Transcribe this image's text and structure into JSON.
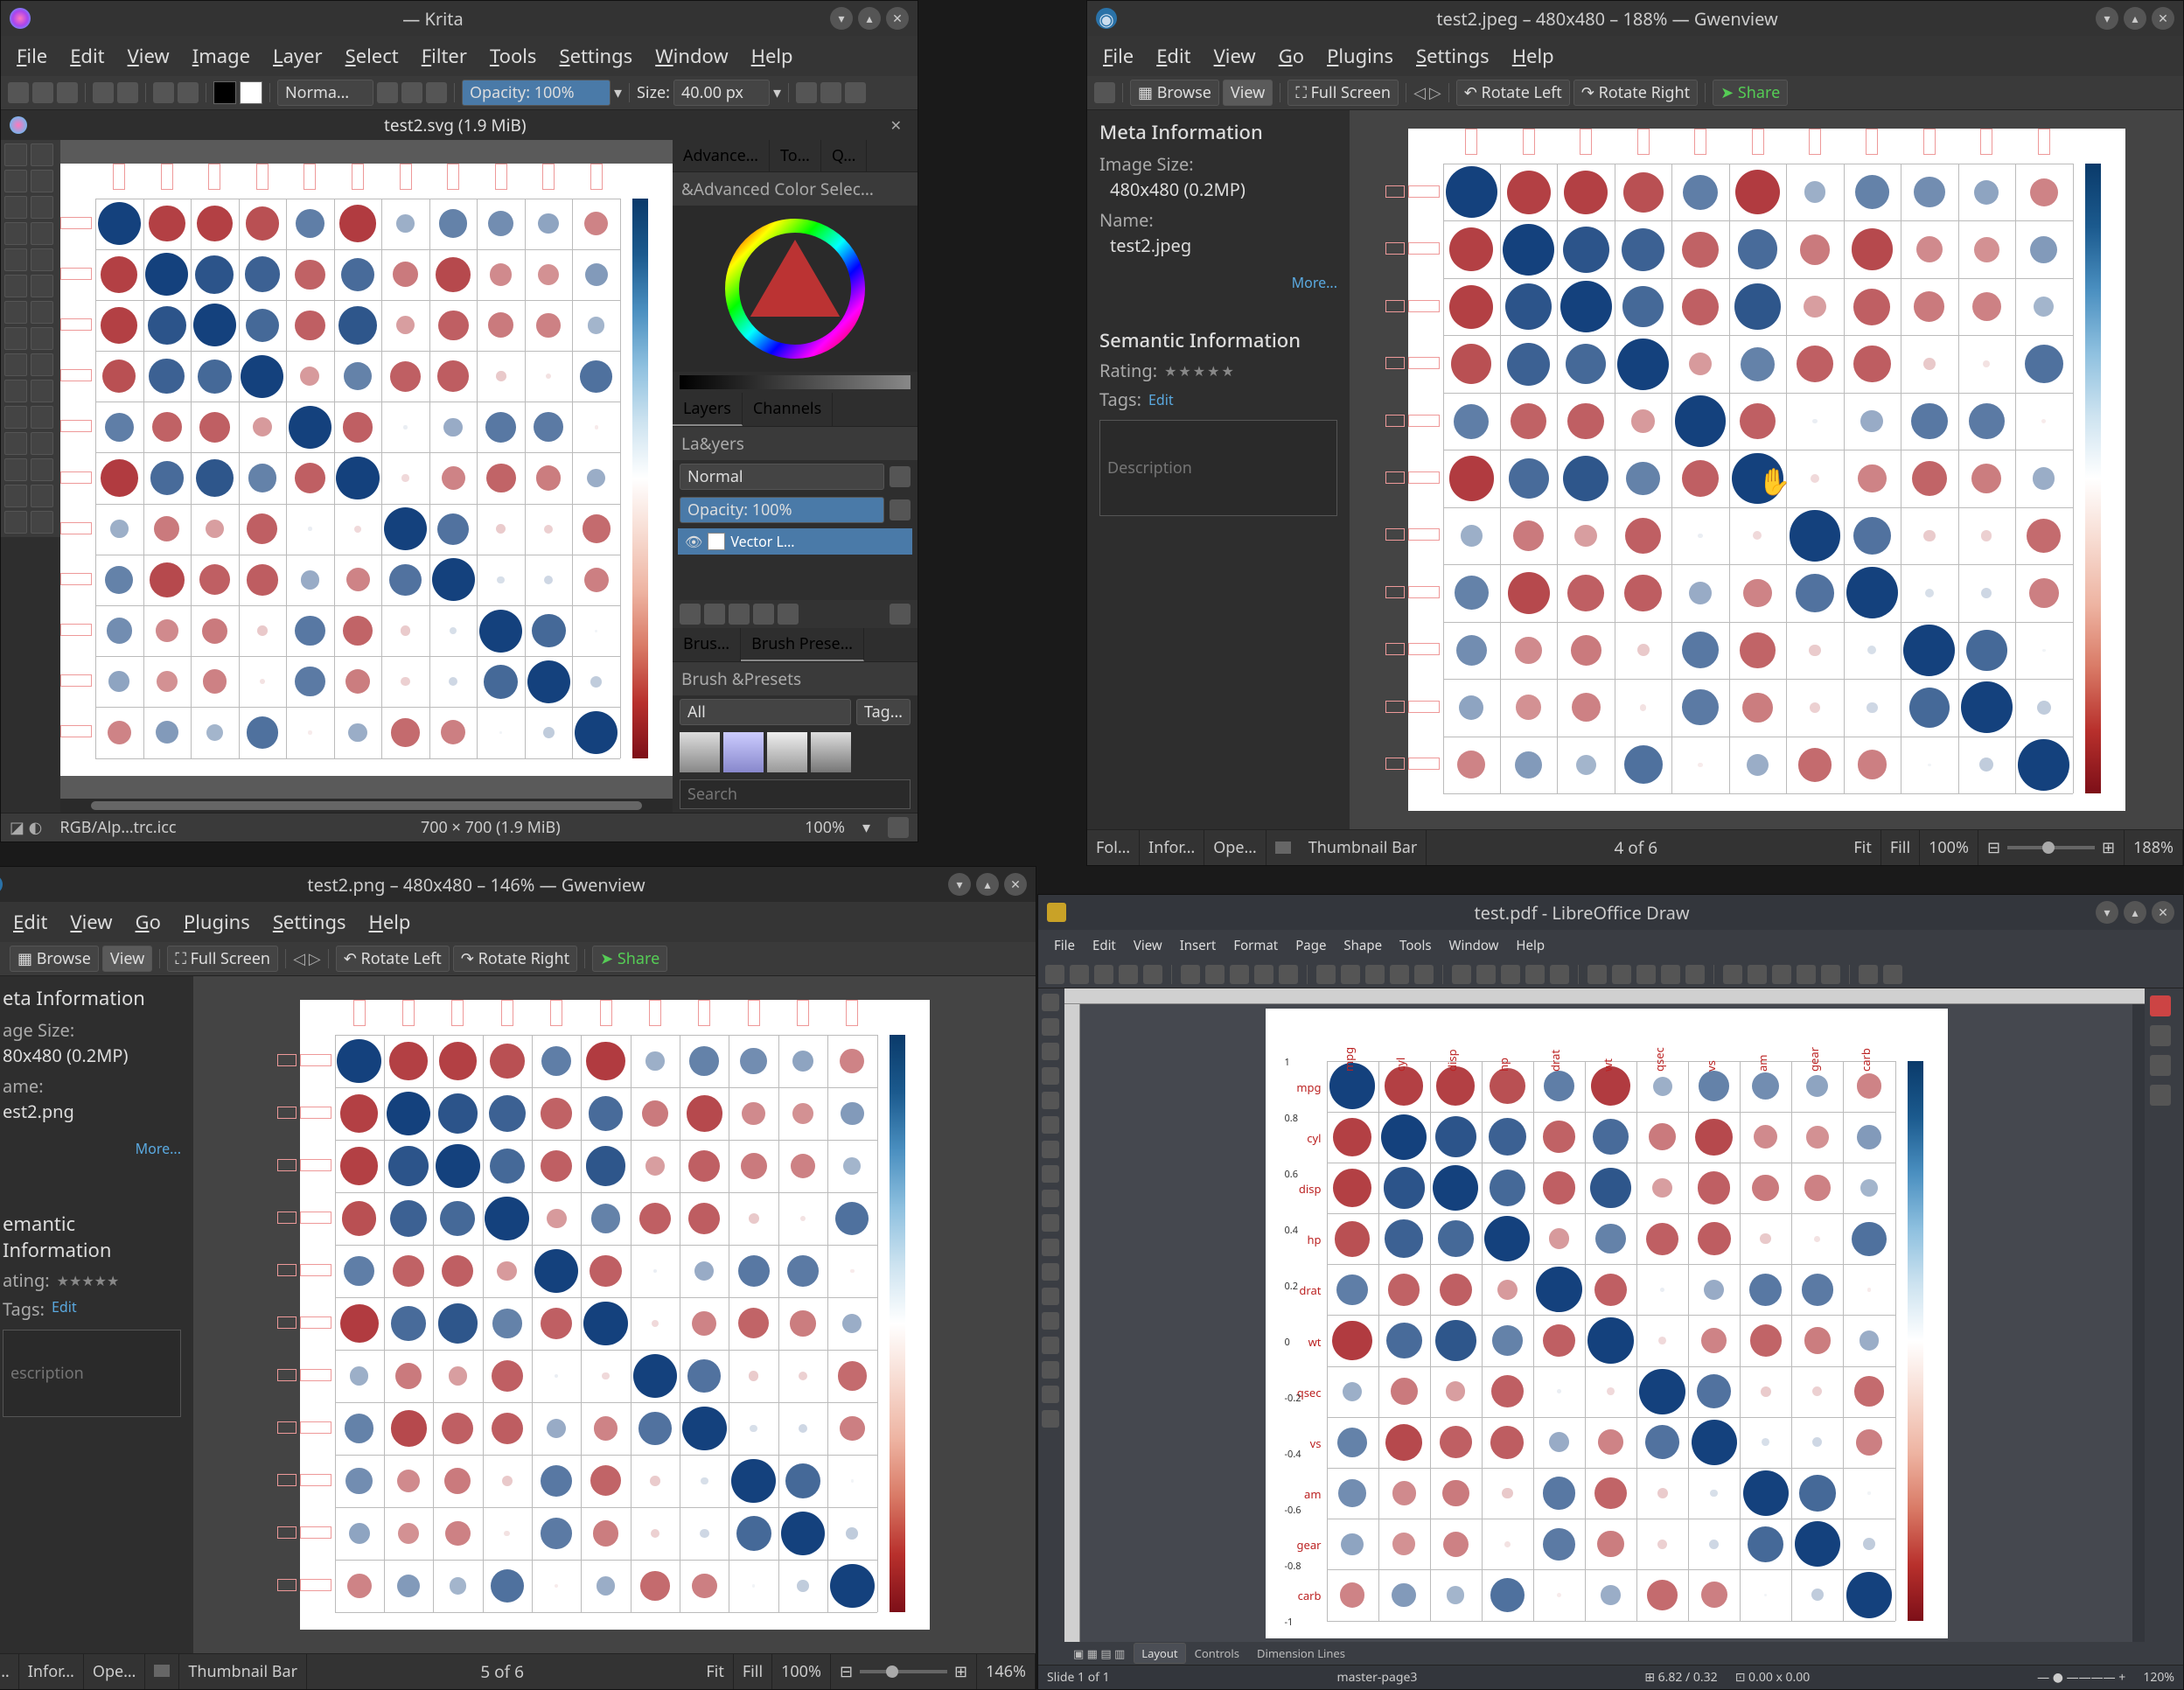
{
  "chart_data": {
    "type": "heatmap",
    "title": "",
    "variables": [
      "mpg",
      "cyl",
      "disp",
      "hp",
      "drat",
      "wt",
      "qsec",
      "vs",
      "am",
      "gear",
      "carb"
    ],
    "matrix": [
      [
        1.0,
        -0.85,
        -0.85,
        -0.78,
        0.68,
        -0.87,
        0.42,
        0.66,
        0.6,
        0.48,
        -0.55
      ],
      [
        -0.85,
        1.0,
        0.9,
        0.83,
        -0.7,
        0.78,
        -0.59,
        -0.81,
        -0.52,
        -0.49,
        0.53
      ],
      [
        -0.85,
        0.9,
        1.0,
        0.79,
        -0.71,
        0.89,
        -0.43,
        -0.71,
        -0.59,
        -0.56,
        0.39
      ],
      [
        -0.78,
        0.83,
        0.79,
        1.0,
        -0.45,
        0.66,
        -0.71,
        -0.72,
        -0.24,
        -0.13,
        0.75
      ],
      [
        0.68,
        -0.7,
        -0.71,
        -0.45,
        1.0,
        -0.71,
        0.09,
        0.44,
        0.71,
        0.7,
        -0.09
      ],
      [
        -0.87,
        0.78,
        0.89,
        0.66,
        -0.71,
        1.0,
        -0.17,
        -0.55,
        -0.69,
        -0.58,
        0.43
      ],
      [
        0.42,
        -0.59,
        -0.43,
        -0.71,
        0.09,
        -0.17,
        1.0,
        0.74,
        -0.23,
        -0.21,
        -0.66
      ],
      [
        0.66,
        -0.81,
        -0.71,
        -0.72,
        0.44,
        -0.55,
        0.74,
        1.0,
        0.17,
        0.21,
        -0.57
      ],
      [
        0.6,
        -0.52,
        -0.59,
        -0.24,
        0.71,
        -0.69,
        -0.23,
        0.17,
        1.0,
        0.79,
        0.06
      ],
      [
        0.48,
        -0.49,
        -0.56,
        -0.13,
        0.7,
        -0.58,
        -0.21,
        0.21,
        0.79,
        1.0,
        0.27
      ],
      [
        -0.55,
        0.53,
        0.39,
        0.75,
        -0.09,
        0.43,
        -0.66,
        -0.57,
        0.06,
        0.27,
        1.0
      ]
    ],
    "colorbar_ticks": [
      1,
      0.8,
      0.6,
      0.4,
      0.2,
      0,
      -0.2,
      -0.4,
      -0.6,
      -0.8,
      -1
    ]
  },
  "krita": {
    "title": "— Krita",
    "menus": [
      "File",
      "Edit",
      "View",
      "Image",
      "Layer",
      "Select",
      "Filter",
      "Tools",
      "Settings",
      "Window",
      "Help"
    ],
    "blend": "Norma…",
    "opacity_label": "Opacity: 100%",
    "size_label": "Size:",
    "size_value": "40.00 px",
    "doc_tab": "test2.svg (1.9 MiB)",
    "panels": {
      "advance": "Advance…",
      "to": "To…",
      "q": "Q…",
      "adv_color": "&Advanced Color Selec…",
      "layers_tab": "Layers",
      "channels_tab": "Channels",
      "layers_title": "La&yers",
      "layer_blend": "Normal",
      "layer_opacity": "Opacity:  100%",
      "layer_name": "Vector L…",
      "brush_tab": "Brus…",
      "preset_tab": "Brush Prese…",
      "preset_title": "Brush &Presets",
      "preset_filter": "All",
      "preset_tag": "Tag…",
      "search_ph": "Search"
    },
    "status": {
      "profile": "RGB/Alp…trc.icc",
      "dims": "700 × 700 (1.9 MiB)",
      "zoom": "100%"
    }
  },
  "gwen_tr": {
    "title": "test2.jpeg – 480x480 – 188% — Gwenview",
    "menus": [
      "File",
      "Edit",
      "View",
      "Go",
      "Plugins",
      "Settings",
      "Help"
    ],
    "tb": {
      "browse": "Browse",
      "view": "View",
      "full": "Full Screen",
      "rotl": "Rotate Left",
      "rotr": "Rotate Right",
      "share": "Share"
    },
    "meta_title": "Meta Information",
    "imgsize_lbl": "Image Size:",
    "imgsize_val": "480x480 (0.2MP)",
    "name_lbl": "Name:",
    "name_val": "test2.jpeg",
    "more": "More...",
    "sem_title": "Semantic Information",
    "rating_lbl": "Rating:",
    "tags_lbl": "Tags:",
    "edit": "Edit",
    "desc_ph": "Description",
    "bottom": {
      "fol": "Fol…",
      "infor": "Infor…",
      "ope": "Ope…",
      "thumb": "Thumbnail Bar",
      "counter": "4 of 6",
      "fit": "Fit",
      "fill": "Fill",
      "pct": "100%",
      "zoom": "188%"
    }
  },
  "gwen_bl": {
    "title": "test2.png – 480x480 – 146% — Gwenview",
    "menus": [
      "Edit",
      "View",
      "Go",
      "Plugins",
      "Settings",
      "Help"
    ],
    "tb": {
      "browse": "Browse",
      "view": "View",
      "full": "Full Screen",
      "rotl": "Rotate Left",
      "rotr": "Rotate Right",
      "share": "Share"
    },
    "meta_title": "eta Information",
    "imgsize_lbl": "age Size:",
    "imgsize_val": "80x480 (0.2MP)",
    "name_lbl": "ame:",
    "name_val": "est2.png",
    "more": "More...",
    "sem_title": "emantic Information",
    "rating_lbl": "ating:",
    "tags_lbl": "Tags:",
    "edit": "Edit",
    "desc_ph": "escription",
    "bottom": {
      "ol": "ol…",
      "infor": "Infor…",
      "ope": "Ope…",
      "thumb": "Thumbnail Bar",
      "counter": "5 of 6",
      "fit": "Fit",
      "fill": "Fill",
      "pct": "100%",
      "zoom": "146%"
    }
  },
  "lodraw": {
    "title": "test.pdf - LibreOffice Draw",
    "menus": [
      "File",
      "Edit",
      "View",
      "Insert",
      "Format",
      "Page",
      "Shape",
      "Tools",
      "Window",
      "Help"
    ],
    "tabs": {
      "layout": "Layout",
      "controls": "Controls",
      "dimlines": "Dimension Lines"
    },
    "status": {
      "slide": "Slide 1 of 1",
      "master": "master-page3",
      "coords": "⊞ 6.82 / 0.32",
      "size": "⊡ 0.00 x 0.00",
      "zoom": "120%"
    }
  }
}
